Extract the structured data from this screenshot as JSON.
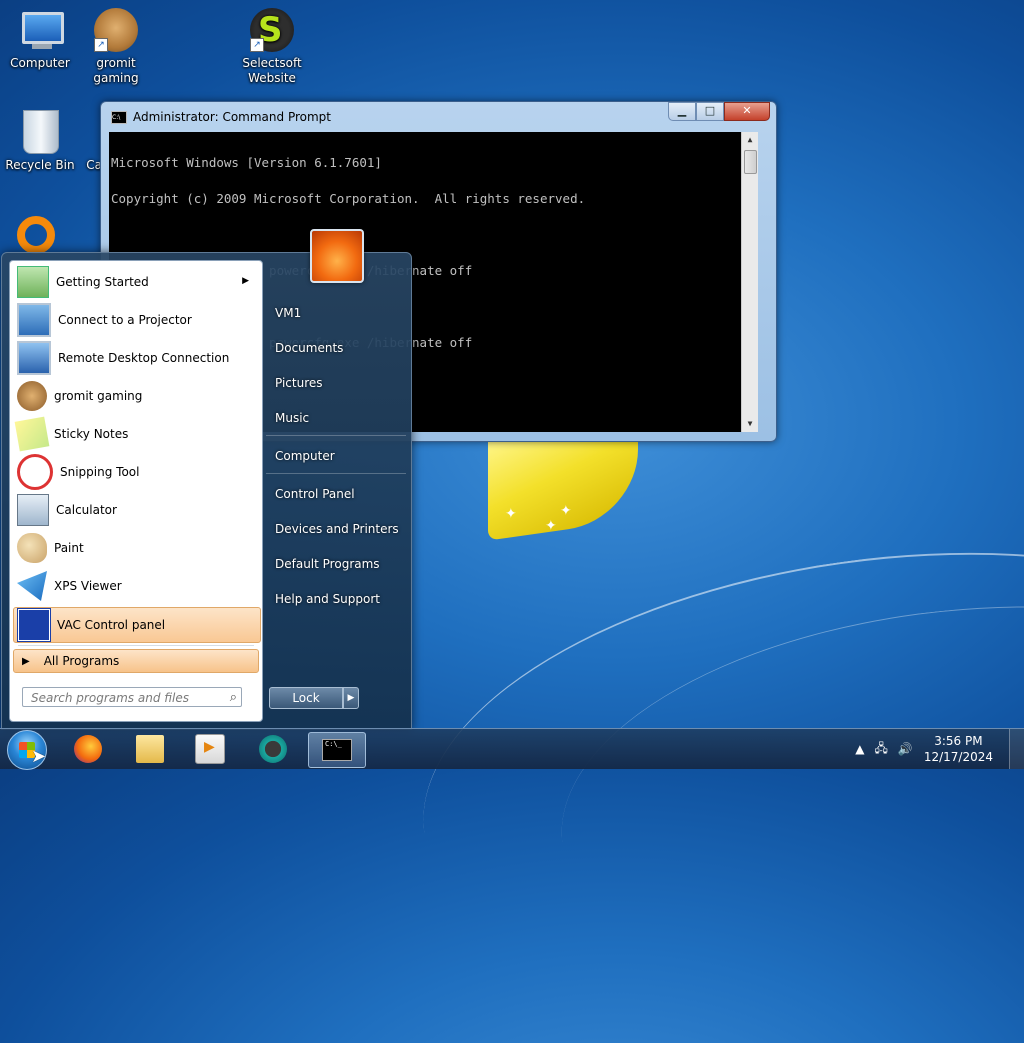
{
  "desktop": {
    "icons": [
      {
        "label": "Computer"
      },
      {
        "label": "gromit gaming"
      },
      {
        "label": "Selectsoft Website"
      },
      {
        "label": "Recycle Bin"
      },
      {
        "label": "Ca"
      }
    ]
  },
  "cmd_window": {
    "title": "Administrator: Command Prompt",
    "lines": [
      "Microsoft Windows [Version 6.1.7601]",
      "Copyright (c) 2009 Microsoft Corporation.  All rights reserved.",
      "",
      "C:\\Windows\\system32> powercfg.exe /hibernate off",
      "",
      "C:\\Windows\\system32> powercfg.exe /hibernate off"
    ]
  },
  "start_menu": {
    "programs": [
      {
        "label": "Getting Started",
        "icon": "getting-started-icon"
      },
      {
        "label": "Connect to a Projector",
        "icon": "projector-icon"
      },
      {
        "label": "Remote Desktop Connection",
        "icon": "remote-desktop-icon"
      },
      {
        "label": "gromit gaming",
        "icon": "gromit-icon"
      },
      {
        "label": "Sticky Notes",
        "icon": "sticky-notes-icon"
      },
      {
        "label": "Snipping Tool",
        "icon": "snipping-tool-icon"
      },
      {
        "label": "Calculator",
        "icon": "calculator-icon"
      },
      {
        "label": "Paint",
        "icon": "paint-icon"
      },
      {
        "label": "XPS Viewer",
        "icon": "xps-viewer-icon"
      },
      {
        "label": "VAC Control panel",
        "icon": "vac-icon"
      }
    ],
    "all_programs": "All Programs",
    "search_placeholder": "Search programs and files",
    "right_links": [
      {
        "label": "VM1"
      },
      {
        "label": "Documents"
      },
      {
        "label": "Pictures"
      },
      {
        "label": "Music"
      },
      {
        "label": "Computer"
      },
      {
        "label": "Control Panel"
      },
      {
        "label": "Devices and Printers"
      },
      {
        "label": "Default Programs"
      },
      {
        "label": "Help and Support"
      }
    ],
    "lock_label": "Lock"
  },
  "taskbar": {
    "clock_time": "3:56 PM",
    "clock_date": "12/17/2024",
    "cmd_icon_text": "C:\\_"
  }
}
